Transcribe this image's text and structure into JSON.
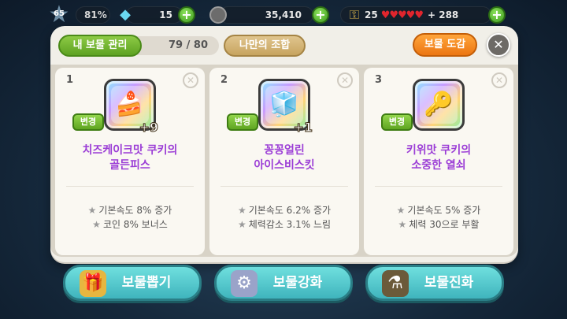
{
  "status": {
    "level": "65",
    "xp_percent": "81%",
    "gems": "15",
    "coins": "35,410",
    "keys": "25",
    "hearts": "♥♥♥♥♥",
    "extra_energy": "+ 288"
  },
  "panel": {
    "tab_manage": "내 보물 관리",
    "count": "79 / 80",
    "tab_combo": "나만의 조합",
    "dogam_button": "보물 도감",
    "close_symbol": "✕"
  },
  "cards": [
    {
      "num": "1",
      "change": "변경",
      "name_line1": "치즈케이크맛 쿠키의",
      "name_line2": "골든피스",
      "plus": "+9",
      "icon": "cheesecake-icon",
      "effect1": "기본속도 8% 증가",
      "effect2": "코인 8% 보너스"
    },
    {
      "num": "2",
      "change": "변경",
      "name_line1": "꽁꽁얼린",
      "name_line2": "아이스비스킷",
      "plus": "+1",
      "icon": "ice-biscuit-icon",
      "effect1": "기본속도 6.2% 증가",
      "effect2": "체력감소 3.1% 느림"
    },
    {
      "num": "3",
      "change": "변경",
      "name_line1": "키위맛 쿠키의",
      "name_line2": "소중한 열쇠",
      "plus": "",
      "icon": "kiwi-key-icon",
      "effect1": "기본속도 5% 증가",
      "effect2": "체력 30으로 부활"
    }
  ],
  "bottom": {
    "draw": "보물뽑기",
    "enhance": "보물강화",
    "evolve": "보물진화"
  },
  "colors": {
    "name_purple": "#9b3dd6",
    "green_button": "#5fa521",
    "orange_button": "#ec7612",
    "teal_button": "#3fb4bd"
  }
}
